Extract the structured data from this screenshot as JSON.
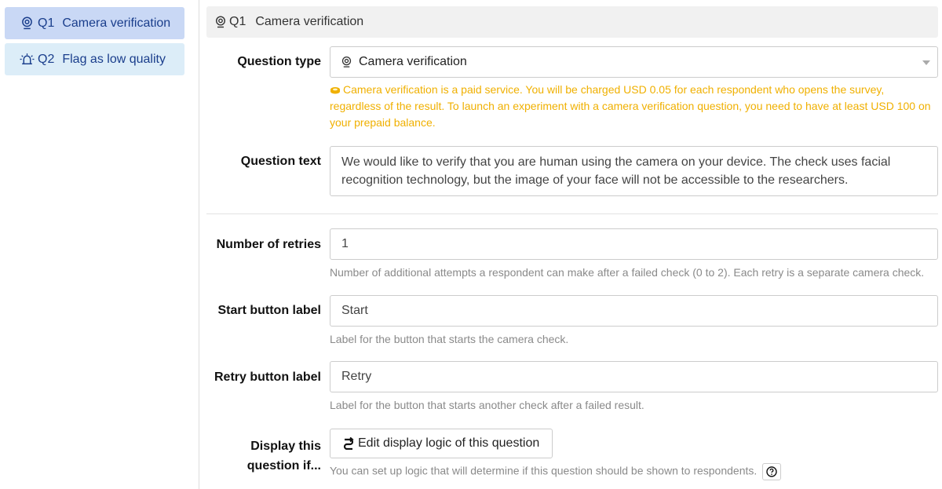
{
  "sidebar": {
    "items": [
      {
        "icon": "camera-pin-icon",
        "num": "Q1",
        "label": "Camera verification",
        "active": true
      },
      {
        "icon": "alarm-flag-icon",
        "num": "Q2",
        "label": "Flag as low quality",
        "active": false
      }
    ]
  },
  "header": {
    "icon": "camera-pin-icon",
    "num": "Q1",
    "title": "Camera verification"
  },
  "form": {
    "question_type": {
      "label": "Question type",
      "value": "Camera verification",
      "icon": "camera-pin-icon",
      "warning": "Camera verification is a paid service. You will be charged USD 0.05 for each respondent who opens the survey, regardless of the result. To launch an experiment with a camera verification question, you need to have at least USD 100 on your prepaid balance."
    },
    "question_text": {
      "label": "Question text",
      "value": "We would like to verify that you are human using the camera on your device. The check uses facial recognition technology, but the image of your face will not be accessible to the researchers."
    },
    "retries": {
      "label": "Number of retries",
      "value": "1",
      "help": "Number of additional attempts a respondent can make after a failed check (0 to 2). Each retry is a separate camera check."
    },
    "start_button": {
      "label": "Start button label",
      "value": "Start",
      "help": "Label for the button that starts the camera check."
    },
    "retry_button": {
      "label": "Retry button label",
      "value": "Retry",
      "help": "Label for the button that starts another check after a failed result."
    },
    "display_logic": {
      "label_line1": "Display this",
      "label_line2": "question if...",
      "button": "Edit display logic of this question",
      "help": "You can set up logic that will determine if this question should be shown to respondents."
    }
  },
  "colors": {
    "sidebar_active": "#c9d8f5",
    "sidebar_inactive": "#dcedf8",
    "link_blue": "#1a3e8c",
    "warning": "#f0b000",
    "help_text": "#8a8a8a"
  }
}
